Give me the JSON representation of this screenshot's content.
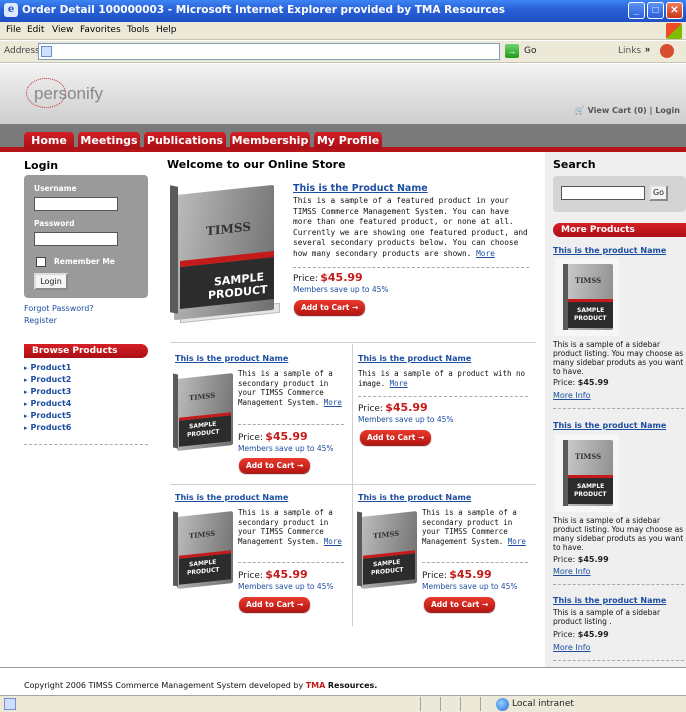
{
  "window": {
    "title": "Order Detail 100000003 - Microsoft Internet Explorer provided by TMA Resources",
    "menu": [
      "File",
      "Edit",
      "View",
      "Favorites",
      "Tools",
      "Help"
    ],
    "address_label": "Address",
    "go_label": "Go",
    "links_label": "Links",
    "links_chevron": "»",
    "minimize_icon": "minimize-icon",
    "maximize_icon": "maximize-icon",
    "close_icon": "close-icon"
  },
  "header": {
    "logo": "personify",
    "cart_text": "View Cart (0)",
    "separator": "|",
    "login_link": "Login"
  },
  "nav": {
    "tabs": [
      "Home",
      "Meetings",
      "Publications",
      "Membership",
      "My Profile"
    ]
  },
  "left": {
    "login_heading": "Login",
    "username_label": "Username",
    "password_label": "Password",
    "remember_label": "Remember Me",
    "login_button": "Login",
    "forgot_link": "Forgot Password?",
    "register_link": "Register",
    "browse_heading": "Browse Products",
    "products": [
      "Product1",
      "Product2",
      "Product3",
      "Product4",
      "Product5",
      "Product6"
    ]
  },
  "center": {
    "heading": "Welcome to our Online Store",
    "featured": {
      "name": "This is the Product Name",
      "desc": "This is a sample of a featured product in your TIMSS Commerce Management System. You can have more than one featured product, or none at all. Currently we are showing one featured product, and several secondary products below. You can choose how many secondary products are shown.",
      "more": "More",
      "price_label": "Price:",
      "price": "$45.99",
      "members": "Members save up to 45%",
      "add": "Add to Cart →"
    },
    "grid": [
      {
        "name": "This is the product Name",
        "desc": "This is a sample of a secondary product in your TIMSS Commerce Management System.",
        "more": "More",
        "price_label": "Price:",
        "price": "$45.99",
        "members": "Members save up to 45%",
        "add": "Add to Cart →"
      },
      {
        "name": "This is the product Name",
        "desc": "This is a sample of a product with no image.",
        "more": "More",
        "price_label": "Price:",
        "price": "$45.99",
        "members": "Members save up to 45%",
        "add": "Add to Cart →"
      },
      {
        "name": "This is the product Name",
        "desc": "This is a sample of a secondary product in your TIMSS Commerce Management System.",
        "more": "More",
        "price_label": "Price:",
        "price": "$45.99",
        "members": "Members save up to 45%",
        "add": "Add to Cart →"
      },
      {
        "name": "This is the product Name",
        "desc": "This is a sample of a secondary product in your TIMSS Commerce Management System.",
        "more": "More",
        "price_label": "Price:",
        "price": "$45.99",
        "members": "Members save up to 45%",
        "add": "Add to Cart →"
      }
    ]
  },
  "right": {
    "search_heading": "Search",
    "search_button": "Go",
    "more_heading": "More Products",
    "items": [
      {
        "name": "This is the product Name",
        "desc": "This is a sample of a sidebar product listing. You may choose as many sidebar produts as you want to have.",
        "price_label": "Price:",
        "price": "$45.99",
        "more_info": "More Info"
      },
      {
        "name": "This is the product Name",
        "desc": "This is a sample of a sidebar product listing. You may choose as many sidebar produts as you want to have.",
        "price_label": "Price:",
        "price": "$45.99",
        "more_info": "More Info"
      },
      {
        "name": "This is the product Name",
        "desc": "This is a sample of a sidebar product listing .",
        "price_label": "Price:",
        "price": "$45.99",
        "more_info": "More Info"
      }
    ]
  },
  "book": {
    "brand": "TIMSS",
    "line1": "SAMPLE",
    "line2": "PRODUCT"
  },
  "footer": {
    "text": "Copyright 2006 TIMSS Commerce Management System developed by",
    "brand_a": "TMA",
    "brand_b": "Resources."
  },
  "status": {
    "zone": "Local intranet"
  },
  "colors": {
    "accent_red": "#c41a1a",
    "link_blue": "#1d4ea0",
    "titlebar_blue": "#2a62d8"
  }
}
